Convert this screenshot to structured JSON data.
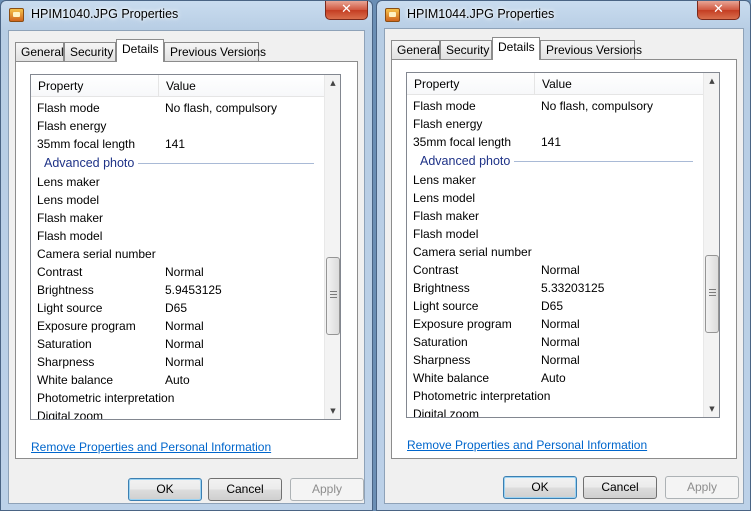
{
  "windows": [
    {
      "title": "HPIM1040.JPG Properties",
      "close_symbol": "✕",
      "tabs": [
        "General",
        "Security",
        "Details",
        "Previous Versions"
      ],
      "active_tab": "Details",
      "columns": {
        "property": "Property",
        "value": "Value"
      },
      "rows": [
        {
          "kind": "row",
          "property": "Flash mode",
          "value": "No flash, compulsory"
        },
        {
          "kind": "row",
          "property": "Flash energy",
          "value": ""
        },
        {
          "kind": "row",
          "property": "35mm focal length",
          "value": "141"
        },
        {
          "kind": "group",
          "property": "Advanced photo",
          "value": ""
        },
        {
          "kind": "row",
          "property": "Lens maker",
          "value": ""
        },
        {
          "kind": "row",
          "property": "Lens model",
          "value": ""
        },
        {
          "kind": "row",
          "property": "Flash maker",
          "value": ""
        },
        {
          "kind": "row",
          "property": "Flash model",
          "value": ""
        },
        {
          "kind": "row",
          "property": "Camera serial number",
          "value": ""
        },
        {
          "kind": "row",
          "property": "Contrast",
          "value": "Normal"
        },
        {
          "kind": "row",
          "property": "Brightness",
          "value": "5.9453125"
        },
        {
          "kind": "row",
          "property": "Light source",
          "value": "D65"
        },
        {
          "kind": "row",
          "property": "Exposure program",
          "value": "Normal"
        },
        {
          "kind": "row",
          "property": "Saturation",
          "value": "Normal"
        },
        {
          "kind": "row",
          "property": "Sharpness",
          "value": "Normal"
        },
        {
          "kind": "row",
          "property": "White balance",
          "value": "Auto"
        },
        {
          "kind": "row",
          "property": "Photometric interpretation",
          "value": ""
        },
        {
          "kind": "row",
          "property": "Digital zoom",
          "value": ""
        }
      ],
      "scroll_position": 0.71,
      "remove_link": "Remove Properties and Personal Information",
      "buttons": {
        "ok": "OK",
        "cancel": "Cancel",
        "apply": "Apply"
      }
    },
    {
      "title": "HPIM1044.JPG Properties",
      "close_symbol": "✕",
      "tabs": [
        "General",
        "Security",
        "Details",
        "Previous Versions"
      ],
      "active_tab": "Details",
      "columns": {
        "property": "Property",
        "value": "Value"
      },
      "rows": [
        {
          "kind": "row",
          "property": "Flash mode",
          "value": "No flash, compulsory"
        },
        {
          "kind": "row",
          "property": "Flash energy",
          "value": ""
        },
        {
          "kind": "row",
          "property": "35mm focal length",
          "value": "141"
        },
        {
          "kind": "group",
          "property": "Advanced photo",
          "value": ""
        },
        {
          "kind": "row",
          "property": "Lens maker",
          "value": ""
        },
        {
          "kind": "row",
          "property": "Lens model",
          "value": ""
        },
        {
          "kind": "row",
          "property": "Flash maker",
          "value": ""
        },
        {
          "kind": "row",
          "property": "Flash model",
          "value": ""
        },
        {
          "kind": "row",
          "property": "Camera serial number",
          "value": ""
        },
        {
          "kind": "row",
          "property": "Contrast",
          "value": "Normal"
        },
        {
          "kind": "row",
          "property": "Brightness",
          "value": "5.33203125"
        },
        {
          "kind": "row",
          "property": "Light source",
          "value": "D65"
        },
        {
          "kind": "row",
          "property": "Exposure program",
          "value": "Normal"
        },
        {
          "kind": "row",
          "property": "Saturation",
          "value": "Normal"
        },
        {
          "kind": "row",
          "property": "Sharpness",
          "value": "Normal"
        },
        {
          "kind": "row",
          "property": "White balance",
          "value": "Auto"
        },
        {
          "kind": "row",
          "property": "Photometric interpretation",
          "value": ""
        },
        {
          "kind": "row",
          "property": "Digital zoom",
          "value": ""
        }
      ],
      "scroll_position": 0.71,
      "remove_link": "Remove Properties and Personal Information",
      "buttons": {
        "ok": "OK",
        "cancel": "Cancel",
        "apply": "Apply"
      }
    }
  ],
  "icons": {
    "app": "image-file-icon",
    "close": "close-icon",
    "scroll_up": "scroll-up-icon",
    "scroll_down": "scroll-down-icon"
  },
  "colors": {
    "link": "#0066cc",
    "group_heading": "#1e3287",
    "close_button": "#c94a30"
  }
}
